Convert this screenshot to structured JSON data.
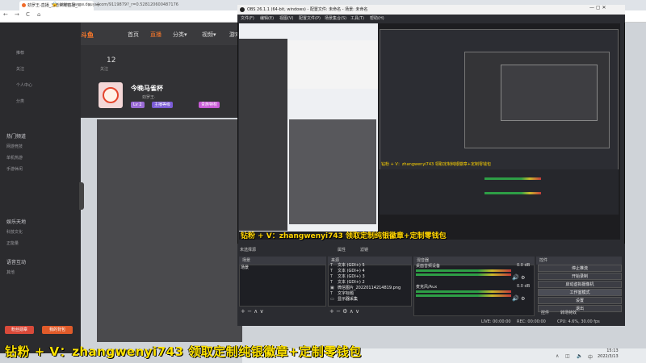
{
  "browser": {
    "tab_title": "劲罗王-直播_王者荣耀直播_斗",
    "url": "https://www.douyu.com/9119879?_r=0.528120600487176",
    "new_tab": "+",
    "back": "←",
    "forward": "→",
    "refresh": "C",
    "home": "⌂"
  },
  "douyu": {
    "logo": "斗鱼",
    "nav": [
      "首页",
      "直播",
      "分类▾",
      "视频▾",
      "游戏▾"
    ],
    "sidebar_items": [
      "推荐",
      "关注",
      "个人中心",
      "分类",
      "热门频道",
      "网游竞技",
      "单机热游",
      "手游休闲",
      "娱乐天地",
      "科技文化",
      "正能量",
      "语音互动",
      "其他"
    ],
    "stat_value": "12",
    "stat_label": "关注",
    "room_title": "今晚马雀杯",
    "streamer": "劲罗王·",
    "tags": [
      "Lv 2",
      "主播等级",
      "贵族特权"
    ],
    "fans_button": "粉丝勋章",
    "gift_button": "我的背包"
  },
  "obs": {
    "title": "OBS 26.1.1 (64-bit, windows) - 配置文件: 未命名 - 场景: 未命名",
    "menu": [
      "文件(F)",
      "编辑(E)",
      "视图(V)",
      "配置文件(P)",
      "场景集合(S)",
      "工具(T)",
      "帮助(H)"
    ],
    "win_buttons": "—  ▢  ✕",
    "overlay_text": "钻粉 + V：zhangwenyi743 领取定制纯银徽章+定制零钱包",
    "status_top": "钻粉 + V：zhangwenyi743 领取定制纯银徽章+定制零钱包",
    "scenes_header": "场景",
    "sources_header": "来源",
    "mixer_header": "混音器",
    "controls_header": "控件",
    "transitions_header": "转场特效",
    "no_source_selected": "未选择源",
    "properties": "属性",
    "filters": "滤镜",
    "scenes": [
      "场景"
    ],
    "sources": [
      {
        "icon": "T",
        "name": "文本 (GDI+) 5"
      },
      {
        "icon": "T",
        "name": "文本 (GDI+) 4"
      },
      {
        "icon": "T",
        "name": "文本 (GDI+) 3"
      },
      {
        "icon": "T",
        "name": "文本 (GDI+) 2"
      },
      {
        "icon": "▣",
        "name": "微信图片_20220114214819.png"
      },
      {
        "icon": "T",
        "name": "文字标题"
      },
      {
        "icon": "▭",
        "name": "显示器采集"
      }
    ],
    "mixer": [
      {
        "name": "桌面音频设备",
        "db": "0.0 dB"
      },
      {
        "name": "麦克风/Aux",
        "db": "0.0 dB"
      }
    ],
    "controls": [
      "停止推流",
      "开始录制",
      "启动虚拟摄像机",
      "工作室模式",
      "设置",
      "退出"
    ],
    "tabs": [
      "控件",
      "转场特效"
    ],
    "status": {
      "live": "LIVE: 00:00:00",
      "rec": "REC: 00:00:00",
      "cpu": "CPU: 4.6%, 30.00 fps"
    }
  },
  "watermark": "钻粉 + V：zhangwenyi743 领取定制纯银徽章+定制零钱包",
  "clock": {
    "time": "15:13",
    "date": "2022/3/13"
  }
}
